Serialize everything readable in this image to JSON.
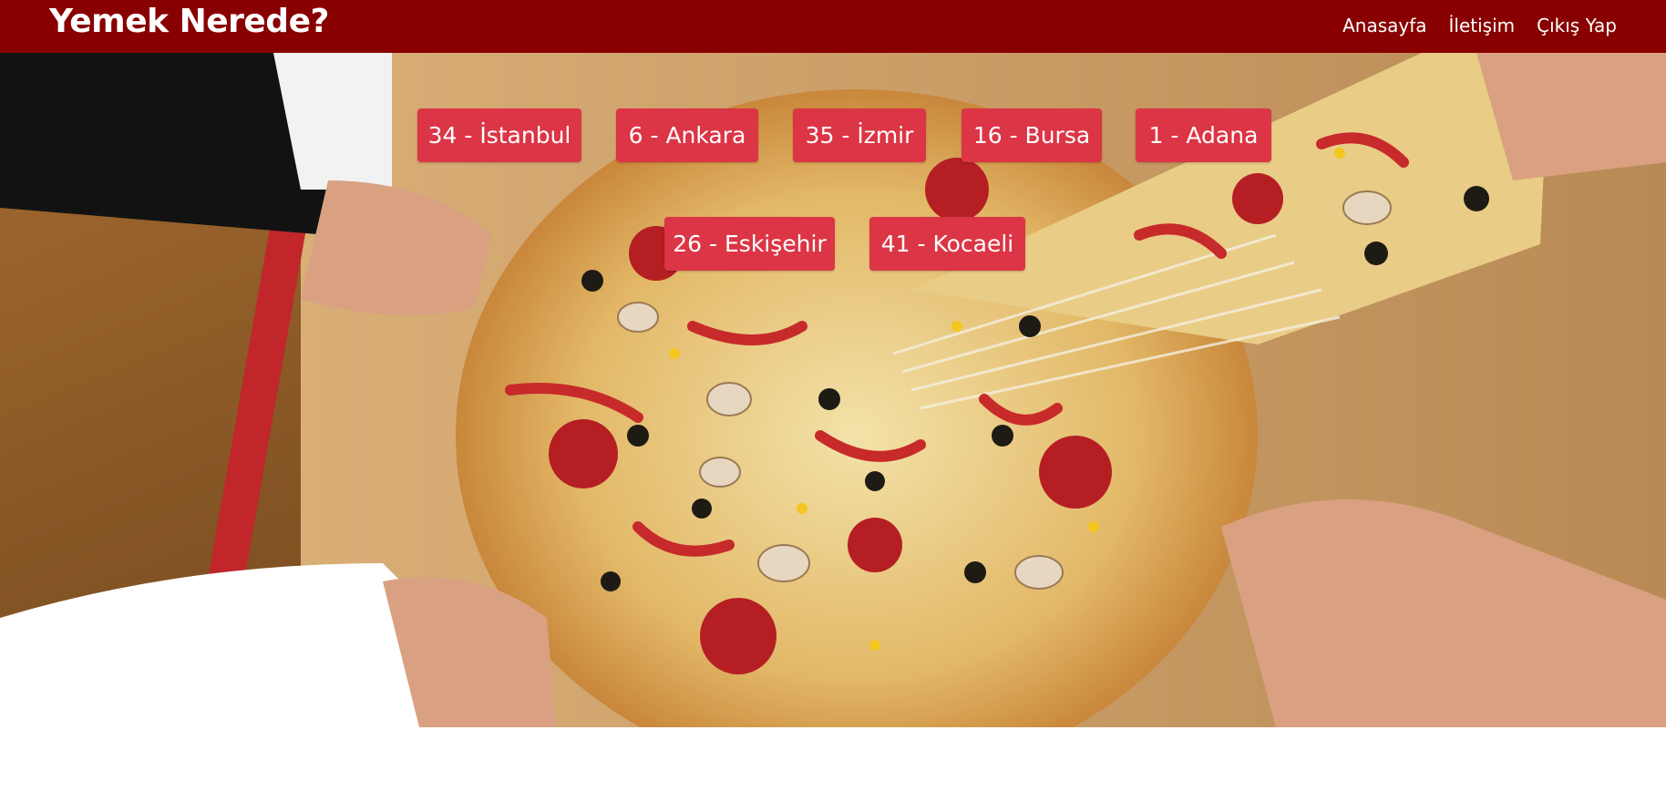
{
  "header": {
    "brand": "Yemek Nerede?",
    "nav": [
      "Anasayfa",
      "İletişim",
      "Çıkış Yap"
    ],
    "background_color": "#880000"
  },
  "hero": {
    "image_description_icon": "pizza-photo",
    "cities": [
      {
        "label": "34 - İstanbul"
      },
      {
        "label": "6 - Ankara"
      },
      {
        "label": "35 - İzmir"
      },
      {
        "label": "16 - Bursa"
      },
      {
        "label": "1 - Adana"
      },
      {
        "label": "26 - Eskişehir"
      },
      {
        "label": "41 - Kocaeli"
      }
    ],
    "button_color": "#dc3545"
  }
}
